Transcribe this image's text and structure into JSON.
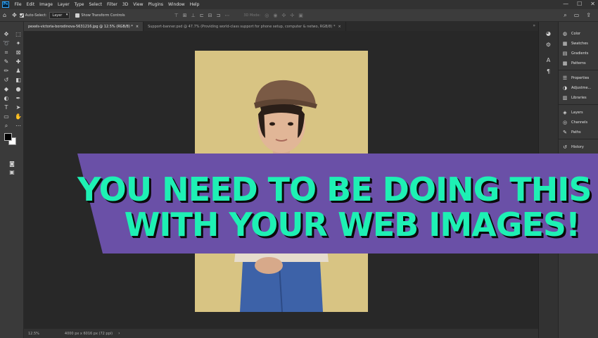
{
  "app": {
    "logo": "Ps",
    "menu": [
      "File",
      "Edit",
      "Image",
      "Layer",
      "Type",
      "Select",
      "Filter",
      "3D",
      "View",
      "Plugins",
      "Window",
      "Help"
    ],
    "window_controls": [
      "—",
      "☐",
      "✕"
    ]
  },
  "options": {
    "auto_select_label": "Auto-Select:",
    "auto_select_value": "Layer",
    "show_transform_label": "Show Transform Controls",
    "mode_3d_label": "3D Mode:"
  },
  "tabs": [
    {
      "label": "pexels-victoria-borodinova-5631216.jpg @ 12.5% (RGB/8) *",
      "close": "×"
    },
    {
      "label": "Support-banner.psd @ 47.7% (Providing world-class support for phone setup, computer & netwo, RGB/8) *",
      "close": "×"
    }
  ],
  "tabs_scroll": "»",
  "status": {
    "zoom": "12.5%",
    "info": "4000 px x 6016 px (72 ppi)",
    "arrow": "›"
  },
  "panels": {
    "group1": [
      "Color",
      "Swatches",
      "Gradients",
      "Patterns"
    ],
    "group2": [
      "Properties",
      "Adjustme...",
      "Libraries"
    ],
    "group3": [
      "Layers",
      "Channels",
      "Paths"
    ],
    "group4": [
      "History"
    ]
  },
  "banner": {
    "line1": "YOU NEED TO BE DOING THIS",
    "line2": "WITH YOUR WEB IMAGES!",
    "bg_color": "#6a50a7",
    "text_color": "#1ef0b4"
  },
  "colors": {
    "canvas_bg": "#282828",
    "doc_bg": "#d8c483",
    "foreground": "#000000",
    "background": "#ffffff"
  }
}
